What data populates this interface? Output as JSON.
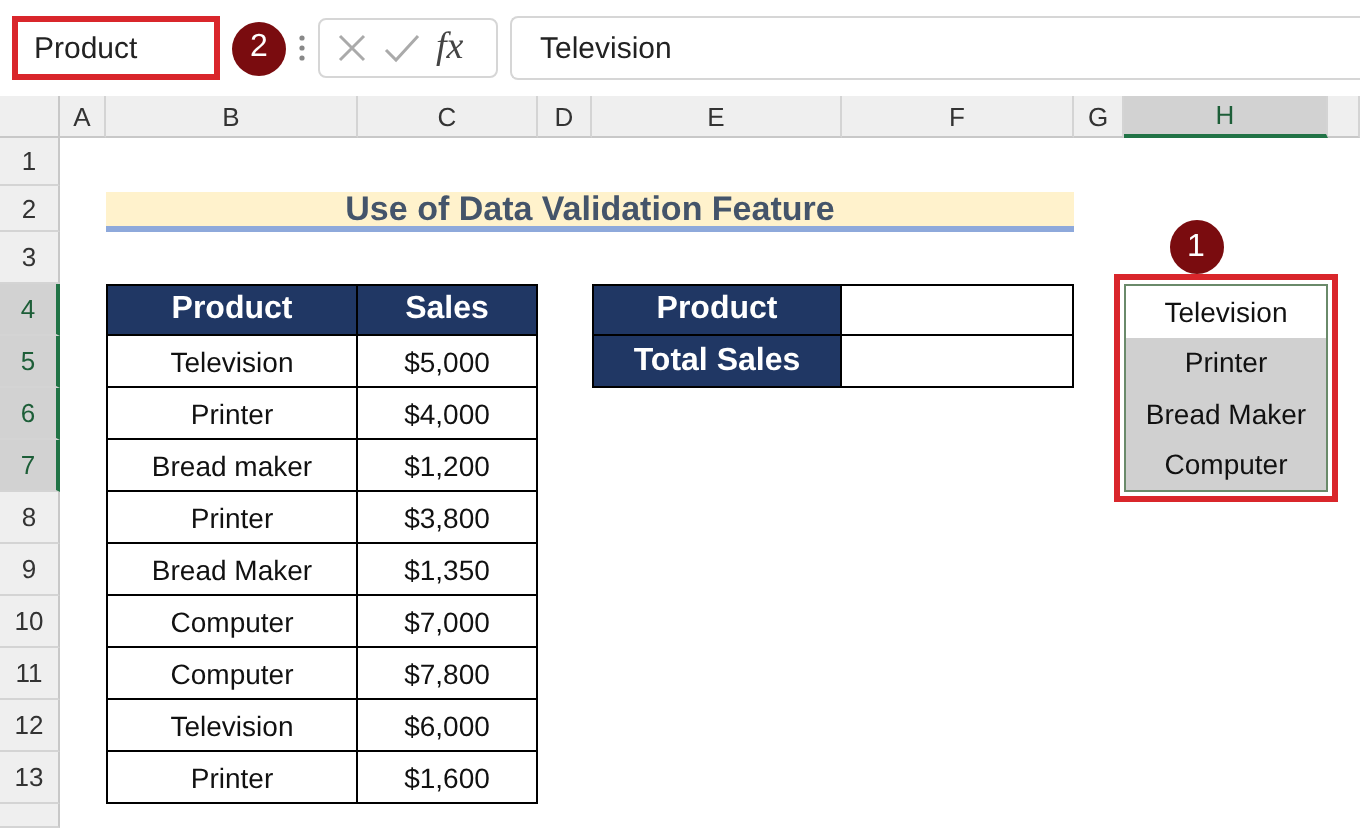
{
  "name_box": {
    "value": "Product",
    "highlighted": true
  },
  "name_box_badge": "2",
  "formula_bar": {
    "function_label": "fx",
    "value": "Television"
  },
  "columns": [
    {
      "label": "A",
      "selected": false
    },
    {
      "label": "B",
      "selected": false
    },
    {
      "label": "C",
      "selected": false
    },
    {
      "label": "D",
      "selected": false
    },
    {
      "label": "E",
      "selected": false
    },
    {
      "label": "F",
      "selected": false
    },
    {
      "label": "G",
      "selected": false
    },
    {
      "label": "H",
      "selected": true
    }
  ],
  "rows": [
    {
      "label": "1",
      "selected": false
    },
    {
      "label": "2",
      "selected": false
    },
    {
      "label": "3",
      "selected": false
    },
    {
      "label": "4",
      "selected": true
    },
    {
      "label": "5",
      "selected": true
    },
    {
      "label": "6",
      "selected": true
    },
    {
      "label": "7",
      "selected": true
    },
    {
      "label": "8",
      "selected": false
    },
    {
      "label": "9",
      "selected": false
    },
    {
      "label": "10",
      "selected": false
    },
    {
      "label": "11",
      "selected": false
    },
    {
      "label": "12",
      "selected": false
    },
    {
      "label": "13",
      "selected": false
    }
  ],
  "title": "Use of Data Validation Feature",
  "sales_table": {
    "columns": [
      "Product",
      "Sales"
    ],
    "rows": [
      [
        "Television",
        "$5,000"
      ],
      [
        "Printer",
        "$4,000"
      ],
      [
        "Bread maker",
        "$1,200"
      ],
      [
        "Printer",
        "$3,800"
      ],
      [
        "Bread Maker",
        "$1,350"
      ],
      [
        "Computer",
        "$7,000"
      ],
      [
        "Computer",
        "$7,800"
      ],
      [
        "Television",
        "$6,000"
      ],
      [
        "Printer",
        "$1,600"
      ]
    ]
  },
  "lookup": [
    {
      "label": "Product"
    },
    {
      "label": "Total Sales"
    }
  ],
  "dropdown": {
    "badge": "1",
    "highlighted": true,
    "items": [
      {
        "label": "Television",
        "selected": true
      },
      {
        "label": "Printer",
        "selected": false
      },
      {
        "label": "Bread Maker",
        "selected": false
      },
      {
        "label": "Computer",
        "selected": false
      }
    ]
  }
}
